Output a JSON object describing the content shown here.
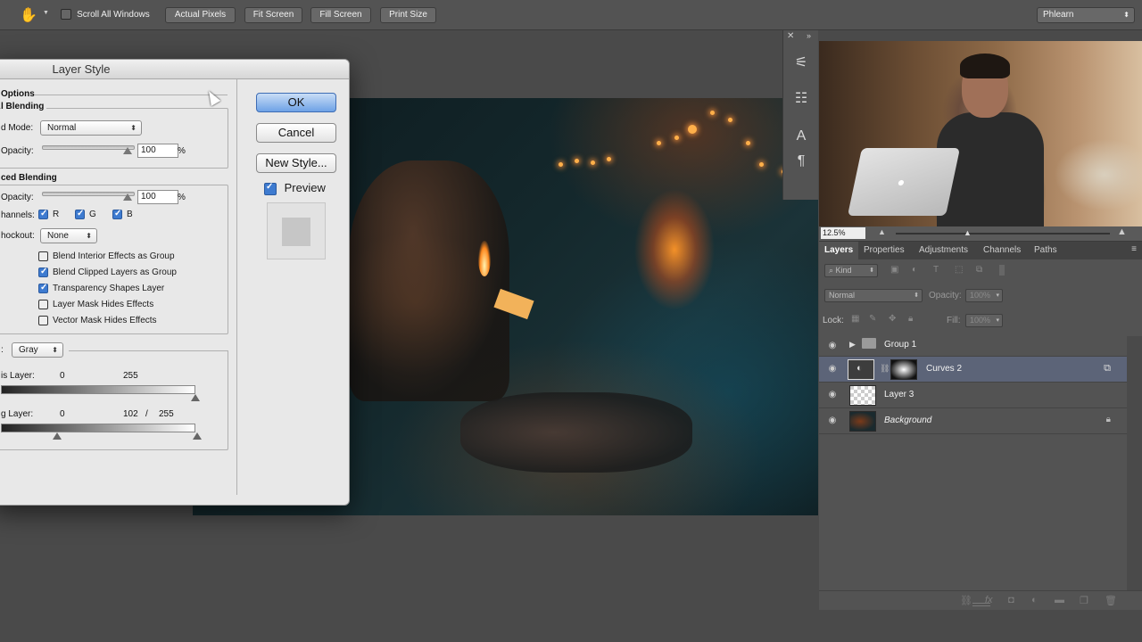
{
  "options_bar": {
    "scroll_all_windows": "Scroll All Windows",
    "actual_pixels": "Actual Pixels",
    "fit_screen": "Fit Screen",
    "fill_screen": "Fill Screen",
    "print_size": "Print Size",
    "workspace": "Phlearn"
  },
  "dialog": {
    "title": "Layer Style",
    "section_options": "Options",
    "general_blending": "l Blending",
    "blend_mode_label": "d Mode:",
    "blend_mode_value": "Normal",
    "opacity_label": "Opacity:",
    "opacity_value": "100",
    "pct": "%",
    "advanced_blending": "ced Blending",
    "fill_opacity_label": "Opacity:",
    "fill_opacity_value": "100",
    "channels_label": "hannels:",
    "channel_r": "R",
    "channel_g": "G",
    "channel_b": "B",
    "knockout_label": "hockout:",
    "knockout_value": "None",
    "checkbox_blend_interior": "Blend Interior Effects as Group",
    "checkbox_blend_clipped": "Blend Clipped Layers as Group",
    "checkbox_transparency": "Transparency Shapes Layer",
    "checkbox_layer_mask": "Layer Mask Hides Effects",
    "checkbox_vector_mask": "Vector Mask Hides Effects",
    "blend_if_label": ":",
    "blend_if_value": "Gray",
    "this_layer_label": "is Layer:",
    "this_layer_min": "0",
    "this_layer_max": "255",
    "underlying_label": "g Layer:",
    "underlying_min": "0",
    "underlying_split": "102",
    "underlying_slash": "/",
    "underlying_max": "255",
    "ok": "OK",
    "cancel": "Cancel",
    "new_style": "New Style...",
    "preview": "Preview"
  },
  "navigator": {
    "zoom": "12.5%"
  },
  "layers_panel": {
    "tabs": [
      "Layers",
      "Properties",
      "Adjustments",
      "Channels",
      "Paths"
    ],
    "kind": "Kind",
    "mode": "Normal",
    "opacity_label": "Opacity:",
    "opacity_value": "100%",
    "lock_label": "Lock:",
    "fill_label": "Fill:",
    "fill_value": "100%",
    "layers": [
      {
        "name": "Group 1"
      },
      {
        "name": "Curves 2"
      },
      {
        "name": "Layer 3"
      },
      {
        "name": "Background"
      }
    ]
  }
}
